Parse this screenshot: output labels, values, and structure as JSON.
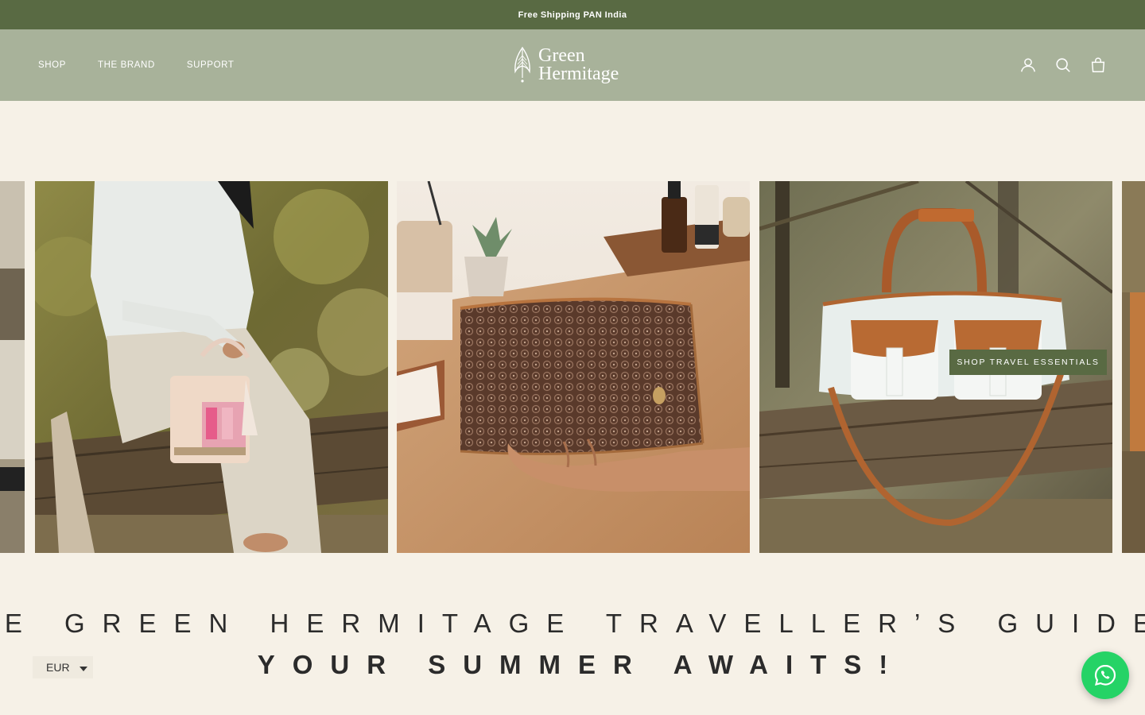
{
  "announcement": {
    "text": "Free Shipping PAN India"
  },
  "nav": {
    "shop": "SHOP",
    "brand": "THE BRAND",
    "support": "SUPPORT"
  },
  "logo": {
    "line1": "Green",
    "line2": "Hermitage"
  },
  "header_icons": [
    "account-icon",
    "search-icon",
    "cart-icon"
  ],
  "carousel": {
    "slides": [
      {
        "name": "slide-partial-left"
      },
      {
        "name": "slide-woman-with-handbag"
      },
      {
        "name": "slide-toiletry-pouch"
      },
      {
        "name": "slide-duffel-bag"
      },
      {
        "name": "slide-partial-right"
      }
    ],
    "cta_label": "SHOP TRAVEL ESSENTIALS"
  },
  "headline": {
    "line1": "HE GREEN HERMITAGE TRAVELLER’S GUIDE",
    "line2": "YOUR SUMMER AWAITS!"
  },
  "currency": {
    "selected": "EUR"
  },
  "colors": {
    "announcement_bg": "#596a43",
    "header_bg": "#a8b29a",
    "page_bg": "#f6f1e7",
    "whatsapp": "#25d366"
  }
}
